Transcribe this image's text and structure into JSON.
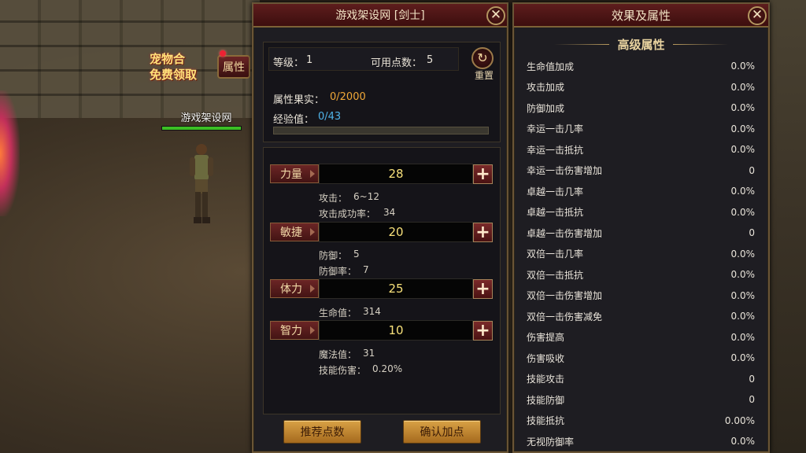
{
  "scene": {
    "player_name": "游戏架设网",
    "promo_line1": "宠物合",
    "promo_line2": "免费领取",
    "attr_tab_label": "属性",
    "hp_fraction": 1.0
  },
  "left_panel": {
    "title": "游戏架设网 [剑士]",
    "close_glyph": "✕",
    "level_label": "等级：",
    "level_value": "1",
    "points_label": "可用点数：",
    "points_value": "5",
    "reset_label": "重置",
    "fruit_label": "属性果实：",
    "fruit_value": "0/2000",
    "exp_label": "经验值：",
    "exp_value": "0/43",
    "exp_fraction": 0.0,
    "stats": [
      {
        "label": "力量",
        "value": "28",
        "details": [
          {
            "label": "攻击：",
            "value": "6~12"
          },
          {
            "label": "攻击成功率：",
            "value": "34"
          }
        ]
      },
      {
        "label": "敏捷",
        "value": "20",
        "details": [
          {
            "label": "防御：",
            "value": "5"
          },
          {
            "label": "防御率：",
            "value": "7"
          }
        ]
      },
      {
        "label": "体力",
        "value": "25",
        "details": [
          {
            "label": "生命值：",
            "value": "314"
          }
        ]
      },
      {
        "label": "智力",
        "value": "10",
        "details": [
          {
            "label": "魔法值：",
            "value": "31"
          },
          {
            "label": "技能伤害：",
            "value": "0.20%"
          }
        ]
      }
    ],
    "plus_glyph": "+",
    "recommend_label": "推荐点数",
    "confirm_label": "确认加点"
  },
  "right_panel": {
    "title": "效果及属性",
    "close_glyph": "✕",
    "section_title": "高级属性",
    "rows": [
      {
        "label": "生命值加成",
        "value": "0.0%"
      },
      {
        "label": "攻击加成",
        "value": "0.0%"
      },
      {
        "label": "防御加成",
        "value": "0.0%"
      },
      {
        "label": "幸运一击几率",
        "value": "0.0%"
      },
      {
        "label": "幸运一击抵抗",
        "value": "0.0%"
      },
      {
        "label": "幸运一击伤害增加",
        "value": "0"
      },
      {
        "label": "卓越一击几率",
        "value": "0.0%"
      },
      {
        "label": "卓越一击抵抗",
        "value": "0.0%"
      },
      {
        "label": "卓越一击伤害增加",
        "value": "0"
      },
      {
        "label": "双倍一击几率",
        "value": "0.0%"
      },
      {
        "label": "双倍一击抵抗",
        "value": "0.0%"
      },
      {
        "label": "双倍一击伤害增加",
        "value": "0.0%"
      },
      {
        "label": "双倍一击伤害减免",
        "value": "0.0%"
      },
      {
        "label": "伤害提高",
        "value": "0.0%"
      },
      {
        "label": "伤害吸收",
        "value": "0.0%"
      },
      {
        "label": "技能攻击",
        "value": "0"
      },
      {
        "label": "技能防御",
        "value": "0"
      },
      {
        "label": "技能抵抗",
        "value": "0.00%"
      },
      {
        "label": "无视防御率",
        "value": "0.0%"
      }
    ]
  }
}
